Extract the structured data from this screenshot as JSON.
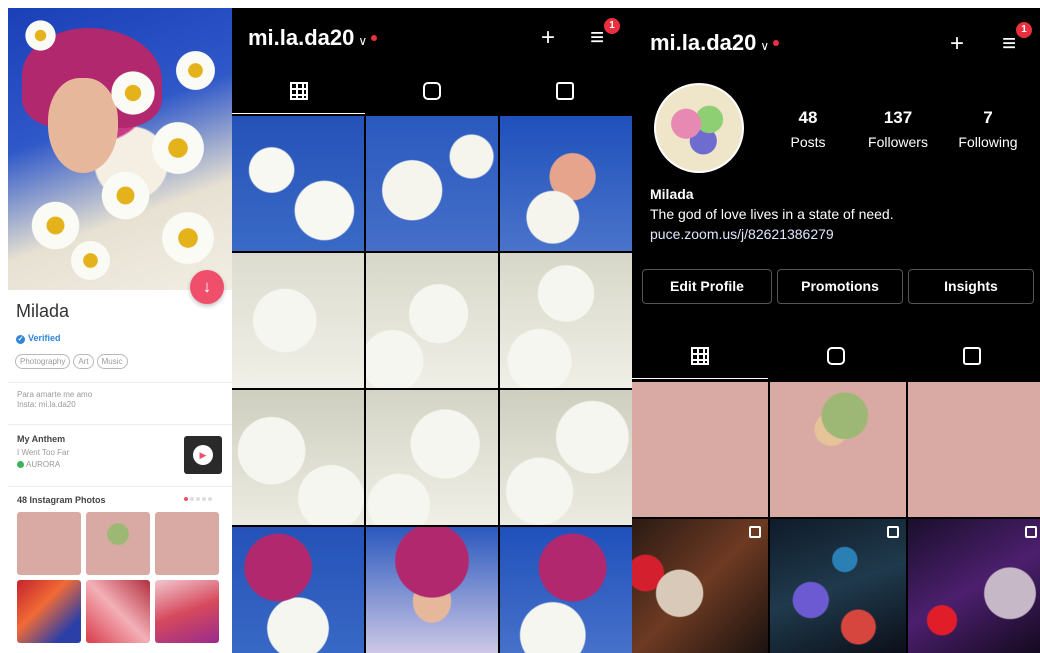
{
  "dating_profile": {
    "name": "Milada",
    "verified_label": "Verified",
    "interests": [
      "Photography",
      "Art",
      "Music"
    ],
    "bio_lines": [
      "Para amarte me amo",
      "Insta: mi.la.da20"
    ],
    "anthem": {
      "heading": "My Anthem",
      "song": "I Went Too Far",
      "artist": "AURORA"
    },
    "instagram_heading": "48 Instagram Photos"
  },
  "ig_grid_view": {
    "username": "mi.la.da20",
    "notification_count": "1"
  },
  "ig_profile": {
    "username": "mi.la.da20",
    "notification_count": "1",
    "stats": [
      {
        "value": "48",
        "label": "Posts"
      },
      {
        "value": "137",
        "label": "Followers"
      },
      {
        "value": "7",
        "label": "Following"
      }
    ],
    "name": "Milada",
    "bio": "The god of love lives in a state of need.",
    "link": "puce.zoom.us/j/82621386279",
    "buttons": [
      "Edit Profile",
      "Promotions",
      "Insights"
    ]
  },
  "colors": {
    "accent_pink": "#ef4f6b",
    "verified_blue": "#2f86d9",
    "notification_red": "#e8303e",
    "tile_pink": "#d9aaa4"
  },
  "icons": [
    "download-icon",
    "verified-icon",
    "play-icon",
    "chevron-down-icon",
    "plus-icon",
    "menu-icon",
    "grid-icon",
    "igtv-icon",
    "tagged-icon",
    "multi-post-icon"
  ]
}
